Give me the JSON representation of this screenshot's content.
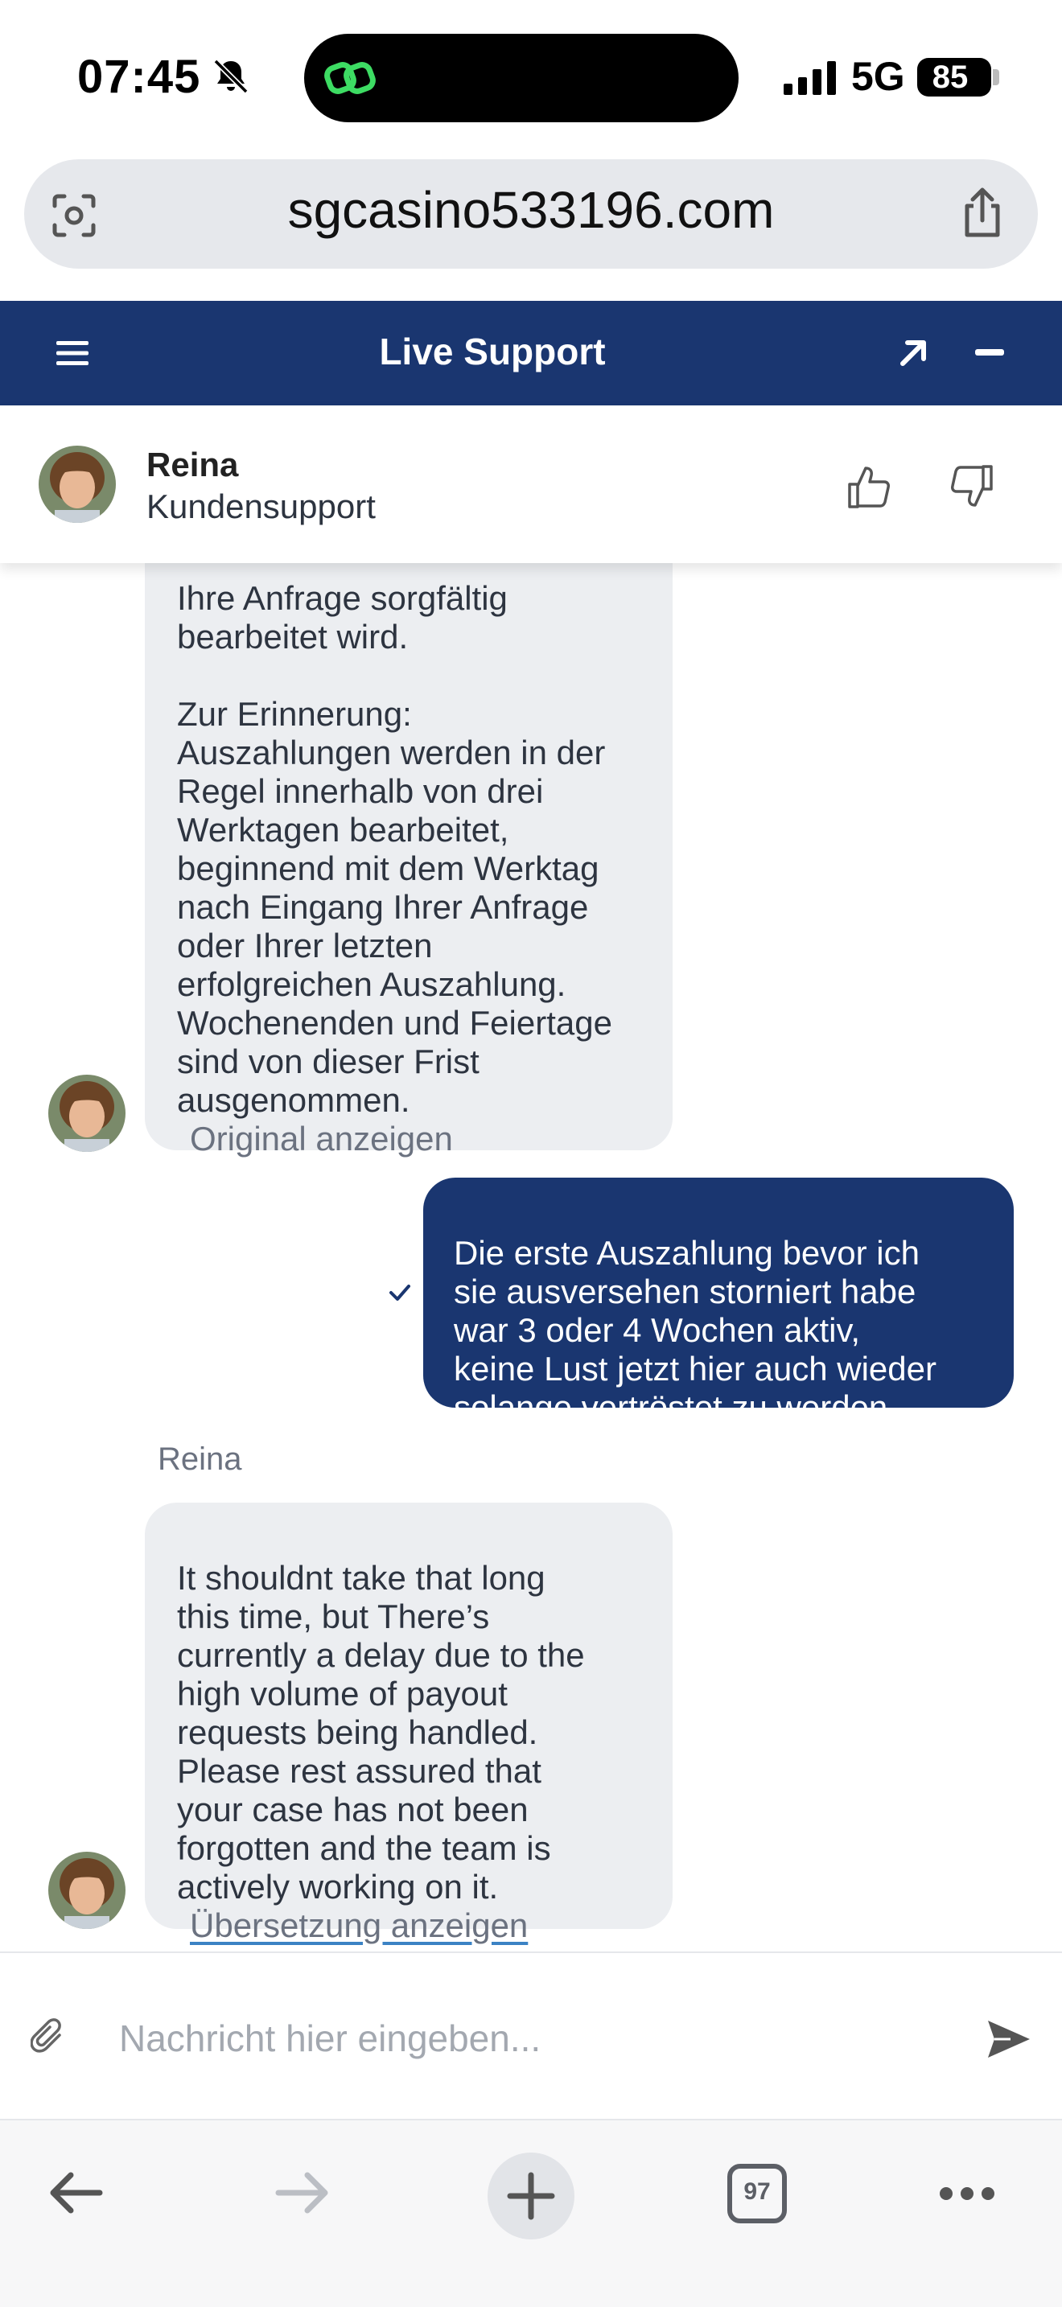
{
  "status_bar": {
    "time": "07:45",
    "network": "5G",
    "battery": "85"
  },
  "browser": {
    "url": "sgcasino533196.com",
    "tab_count": "97"
  },
  "header": {
    "title": "Live Support"
  },
  "agent": {
    "name": "Reina",
    "role": "Kundensupport"
  },
  "messages": [
    {
      "sender": "agent",
      "text": "Ihre Anfrage sorgfältig\nbearbeitet wird.\n\nZur Erinnerung:\nAuszahlungen werden in der\nRegel innerhalb von drei\nWerktagen bearbeitet,\nbeginnend mit dem Werktag\nnach Eingang Ihrer Anfrage\noder Ihrer letzten\nerfolgreichen Auszahlung.\nWochenenden und Feiertage\nsind von dieser Frist\nausgenommen.",
      "link": "Original anzeigen"
    },
    {
      "sender": "user",
      "text": "Die erste Auszahlung bevor ich\nsie ausversehen storniert habe\nwar 3 oder 4 Wochen aktiv,\nkeine Lust jetzt hier auch wieder\nsolange vertröstet zu werden"
    },
    {
      "sender": "agent",
      "sender_label": "Reina",
      "text": "It shouldnt take that long\nthis time, but  There’s\ncurrently a delay due to the\nhigh volume of payout\nrequests being handled.\nPlease rest assured that\nyour case has not been\nforgotten and the team is\nactively working on it.",
      "link": "Übersetzung anzeigen"
    }
  ],
  "composer": {
    "placeholder": "Nachricht hier eingeben..."
  },
  "colors": {
    "brand_navy": "#1a3670",
    "agent_bubble": "#eceef1",
    "link_underline": "#3b82c4"
  },
  "icons": [
    "bell-slash-icon",
    "signal-icon",
    "lens-icon",
    "share-icon",
    "menu-icon",
    "expand-icon",
    "minimize-icon",
    "thumb-up-icon",
    "thumb-down-icon",
    "check-icon",
    "attach-icon",
    "send-icon",
    "back-icon",
    "forward-icon",
    "plus-icon",
    "more-icon"
  ]
}
